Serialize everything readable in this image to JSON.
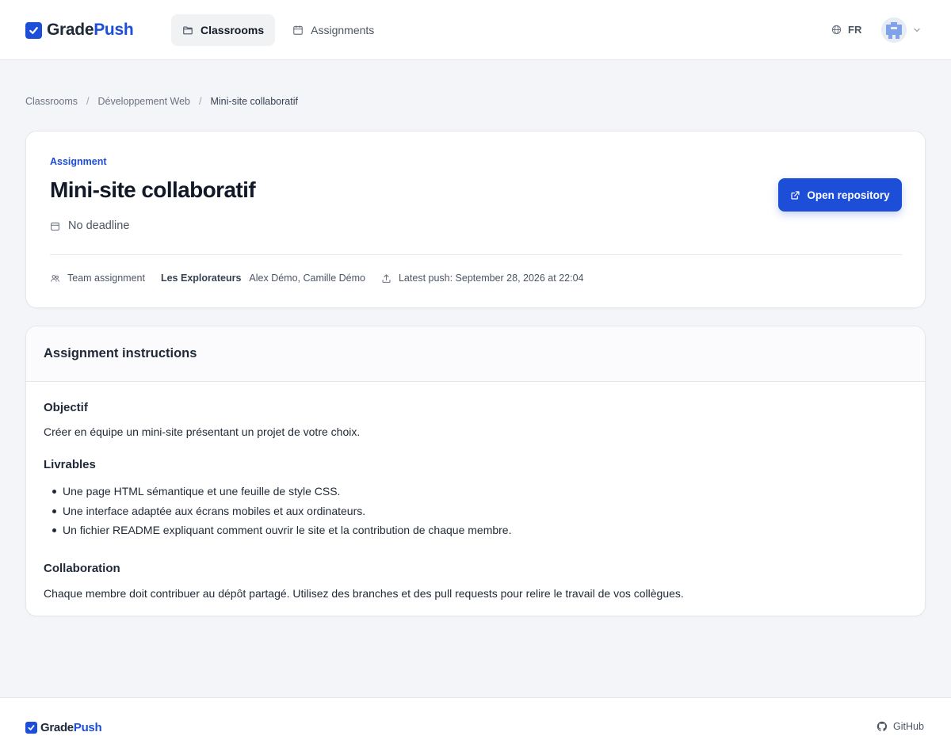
{
  "brand": {
    "name_part1": "Grade",
    "name_part2": "Push",
    "accent_color": "#1d4ed8"
  },
  "nav": [
    {
      "label": "Classrooms",
      "icon": "folder-icon",
      "active": true
    },
    {
      "label": "Assignments",
      "icon": "calendar-icon",
      "active": false
    }
  ],
  "language": {
    "label": "FR",
    "icon": "globe-icon"
  },
  "user_menu": {
    "avatar_icon": "identicon-avatar",
    "chevron_icon": "chevron-down-icon"
  },
  "breadcrumb": [
    "Classrooms",
    "Développement Web",
    "Mini-site collaboratif"
  ],
  "assignment": {
    "eyebrow": "Assignment",
    "title": "Mini-site collaboratif",
    "deadline": "No deadline",
    "open_repo_label": "Open repository",
    "team_type": "Team assignment",
    "team_name": "Les Explorateurs",
    "members": "Alex Démo, Camille Démo",
    "latest_push": "Latest push: September 28, 2026 at 22:04"
  },
  "instructions": {
    "heading": "Assignment instructions",
    "sections": [
      {
        "title": "Objectif",
        "text": "Créer en équipe un mini-site présentant un projet de votre choix."
      },
      {
        "title": "Livrables",
        "items": [
          "Une page HTML sémantique et une feuille de style CSS.",
          "Une interface adaptée aux écrans mobiles et aux ordinateurs.",
          "Un fichier README expliquant comment ouvrir le site et la contribution de chaque membre."
        ]
      },
      {
        "title": "Collaboration",
        "text": "Chaque membre doit contribuer au dépôt partagé. Utilisez des branches et des pull requests pour relire le travail de vos collègues."
      }
    ]
  },
  "footer": {
    "brand_part1": "Grade",
    "brand_part2": "Push",
    "github_label": "GitHub"
  }
}
